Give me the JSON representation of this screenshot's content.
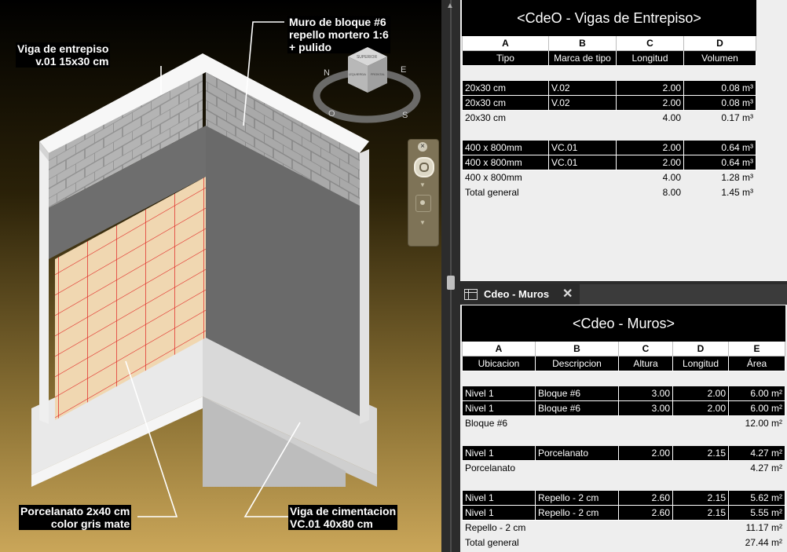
{
  "viewport": {
    "callouts": {
      "viga_entrepiso": [
        "Viga de entrepiso",
        "v.01 15x30 cm"
      ],
      "muro_bloque": [
        "Muro de bloque #6",
        "repello mortero 1:6",
        "+ pulido"
      ],
      "porcelanato": [
        "Porcelanato 2x40 cm",
        "color gris mate"
      ],
      "viga_cimentacion": [
        "Viga de cimentacion",
        "VC.01 40x80 cm"
      ]
    },
    "viewcube": {
      "compass": [
        "N",
        "E",
        "S",
        "O"
      ],
      "face_labels": [
        "SUPERIOR",
        "IZQUIERDA",
        "FRONTAL"
      ]
    },
    "navbar": {
      "close_glyph": "×",
      "up_glyph": "▲",
      "down_glyph": "▼"
    }
  },
  "schedule_vigas": {
    "title": "<CdeO - Vigas de Entrepiso>",
    "letters": [
      "A",
      "B",
      "C",
      "D"
    ],
    "headers": [
      "Tipo",
      "Marca de tipo",
      "Longitud",
      "Volumen"
    ],
    "rows": [
      {
        "kind": "blank",
        "cells": [
          "",
          "",
          "",
          ""
        ]
      },
      {
        "kind": "row",
        "cells": [
          "20x30 cm",
          "V.02",
          "2.00",
          "0.08 m³"
        ]
      },
      {
        "kind": "row",
        "cells": [
          "20x30 cm",
          "V.02",
          "2.00",
          "0.08 m³"
        ]
      },
      {
        "kind": "sub",
        "cells": [
          "20x30 cm",
          "",
          "4.00",
          "0.17 m³"
        ]
      },
      {
        "kind": "blank",
        "cells": [
          "",
          "",
          "",
          ""
        ]
      },
      {
        "kind": "row",
        "cells": [
          "400 x 800mm",
          "VC.01",
          "2.00",
          "0.64 m³"
        ]
      },
      {
        "kind": "row",
        "cells": [
          "400 x 800mm",
          "VC.01",
          "2.00",
          "0.64 m³"
        ]
      },
      {
        "kind": "sub",
        "cells": [
          "400 x 800mm",
          "",
          "4.00",
          "1.28 m³"
        ]
      },
      {
        "kind": "sub",
        "cells": [
          "Total general",
          "",
          "8.00",
          "1.45 m³"
        ]
      }
    ]
  },
  "schedule_muros": {
    "tab_label": "Cdeo - Muros",
    "tab_close": "✕",
    "title": "<Cdeo - Muros>",
    "letters": [
      "A",
      "B",
      "C",
      "D",
      "E"
    ],
    "headers": [
      "Ubicacion",
      "Descripcion",
      "Altura",
      "Longitud",
      "Área"
    ],
    "rows": [
      {
        "kind": "blank",
        "cells": [
          "",
          "",
          "",
          "",
          ""
        ]
      },
      {
        "kind": "row",
        "cells": [
          "Nivel 1",
          "Bloque #6",
          "3.00",
          "2.00",
          "6.00 m²"
        ]
      },
      {
        "kind": "row",
        "cells": [
          "Nivel 1",
          "Bloque #6",
          "3.00",
          "2.00",
          "6.00 m²"
        ]
      },
      {
        "kind": "sub",
        "cells": [
          "Bloque #6",
          "",
          "",
          "",
          "12.00 m²"
        ]
      },
      {
        "kind": "blank",
        "cells": [
          "",
          "",
          "",
          "",
          ""
        ]
      },
      {
        "kind": "row",
        "cells": [
          "Nivel 1",
          "Porcelanato",
          "2.00",
          "2.15",
          "4.27 m²"
        ]
      },
      {
        "kind": "sub",
        "cells": [
          "Porcelanato",
          "",
          "",
          "",
          "4.27 m²"
        ]
      },
      {
        "kind": "blank",
        "cells": [
          "",
          "",
          "",
          "",
          ""
        ]
      },
      {
        "kind": "row",
        "cells": [
          "Nivel 1",
          "Repello - 2 cm",
          "2.60",
          "2.15",
          "5.62 m²"
        ]
      },
      {
        "kind": "row",
        "cells": [
          "Nivel 1",
          "Repello - 2 cm",
          "2.60",
          "2.15",
          "5.55 m²"
        ]
      },
      {
        "kind": "sub",
        "cells": [
          "Repello - 2 cm",
          "",
          "",
          "",
          "11.17 m²"
        ]
      },
      {
        "kind": "sub",
        "cells": [
          "Total general",
          "",
          "",
          "",
          "27.44 m²"
        ]
      }
    ]
  }
}
